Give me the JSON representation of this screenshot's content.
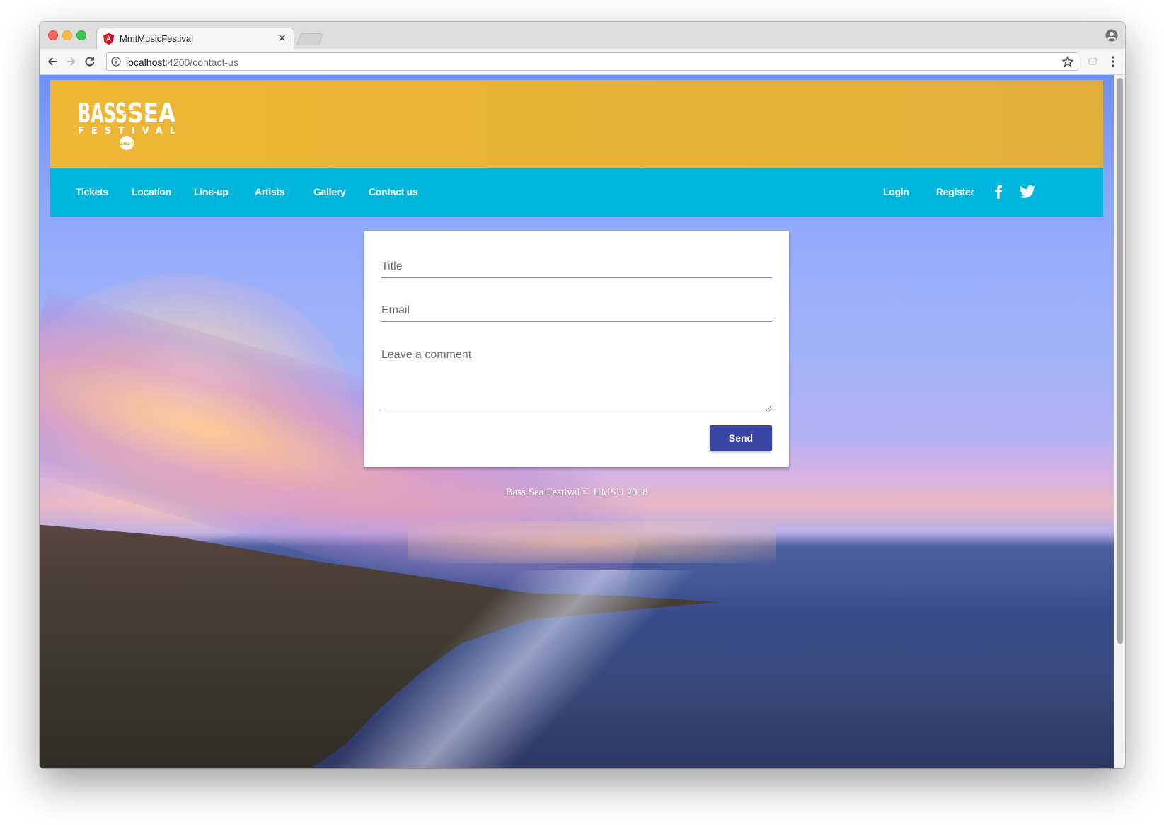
{
  "browser": {
    "tab_title": "MmtMusicFestival",
    "url_host": "localhost",
    "url_path": ":4200/contact-us",
    "colors": {
      "angular_favicon": "#dd1b16"
    }
  },
  "site": {
    "logo": {
      "word1": "BASS",
      "word2": "SEA",
      "subtitle": "FESTIVAL",
      "year": "2017"
    },
    "nav": {
      "tickets": "Tickets",
      "location": "Location",
      "lineup": "Line-up",
      "artists": "Artists",
      "gallery": "Gallery",
      "contact": "Contact us",
      "login": "Login",
      "register": "Register"
    },
    "social": [
      "facebook-icon",
      "twitter-icon"
    ],
    "colors": {
      "header": "#eeb735",
      "navbar": "#00b6dc",
      "send_button": "#3a45a3"
    }
  },
  "form": {
    "title_placeholder": "Title",
    "email_placeholder": "Email",
    "comment_placeholder": "Leave a comment",
    "title_value": "",
    "email_value": "",
    "send_label": "Send"
  },
  "footer": {
    "text": "Bass Sea Festival © HMSU 2018"
  }
}
